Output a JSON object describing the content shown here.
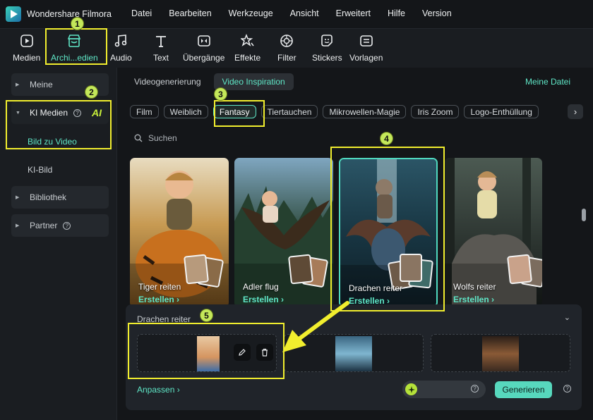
{
  "app": {
    "name": "Wondershare Filmora"
  },
  "menu": [
    "Datei",
    "Bearbeiten",
    "Werkzeuge",
    "Ansicht",
    "Erweitert",
    "Hilfe",
    "Version"
  ],
  "toolbar": [
    {
      "label": "Medien",
      "icon": "media-icon"
    },
    {
      "label": "Archi...edien",
      "icon": "store-icon"
    },
    {
      "label": "Audio",
      "icon": "music-note-icon"
    },
    {
      "label": "Text",
      "icon": "text-icon"
    },
    {
      "label": "Übergänge",
      "icon": "transition-icon"
    },
    {
      "label": "Effekte",
      "icon": "effects-icon"
    },
    {
      "label": "Filter",
      "icon": "filter-icon"
    },
    {
      "label": "Stickers",
      "icon": "sticker-icon"
    },
    {
      "label": "Vorlagen",
      "icon": "template-icon"
    }
  ],
  "sidebar": {
    "meine": "Meine",
    "ki_medien": "KI Medien",
    "ai_badge": "AI",
    "bild_zu_video": "Bild zu Video",
    "ki_bild": "KI-Bild",
    "bibliothek": "Bibliothek",
    "partner": "Partner"
  },
  "tabs": [
    "Videogenerierung",
    "Video Inspiration"
  ],
  "meine_datei": "Meine Datei",
  "chips": [
    "Film",
    "Weiblich",
    "Fantasy",
    "Tiertauchen",
    "Mikrowellen-Magie",
    "Iris Zoom",
    "Logo-Enthüllung"
  ],
  "search_placeholder": "Suchen",
  "cards": [
    {
      "title": "Tiger reiten",
      "action": "Erstellen"
    },
    {
      "title": "Adler flug",
      "action": "Erstellen"
    },
    {
      "title": "Drachen reiter",
      "action": "Erstellen"
    },
    {
      "title": "Wolfs reiter",
      "action": "Erstellen"
    }
  ],
  "bottom": {
    "title": "Drachen reiter",
    "anpassen": "Anpassen",
    "generate": "Generieren"
  },
  "annotations": [
    "1",
    "2",
    "3",
    "4",
    "5"
  ],
  "colors": {
    "accent": "#5fe6c6",
    "highlight": "#f1ee2e",
    "badge": "#c4e85a"
  }
}
